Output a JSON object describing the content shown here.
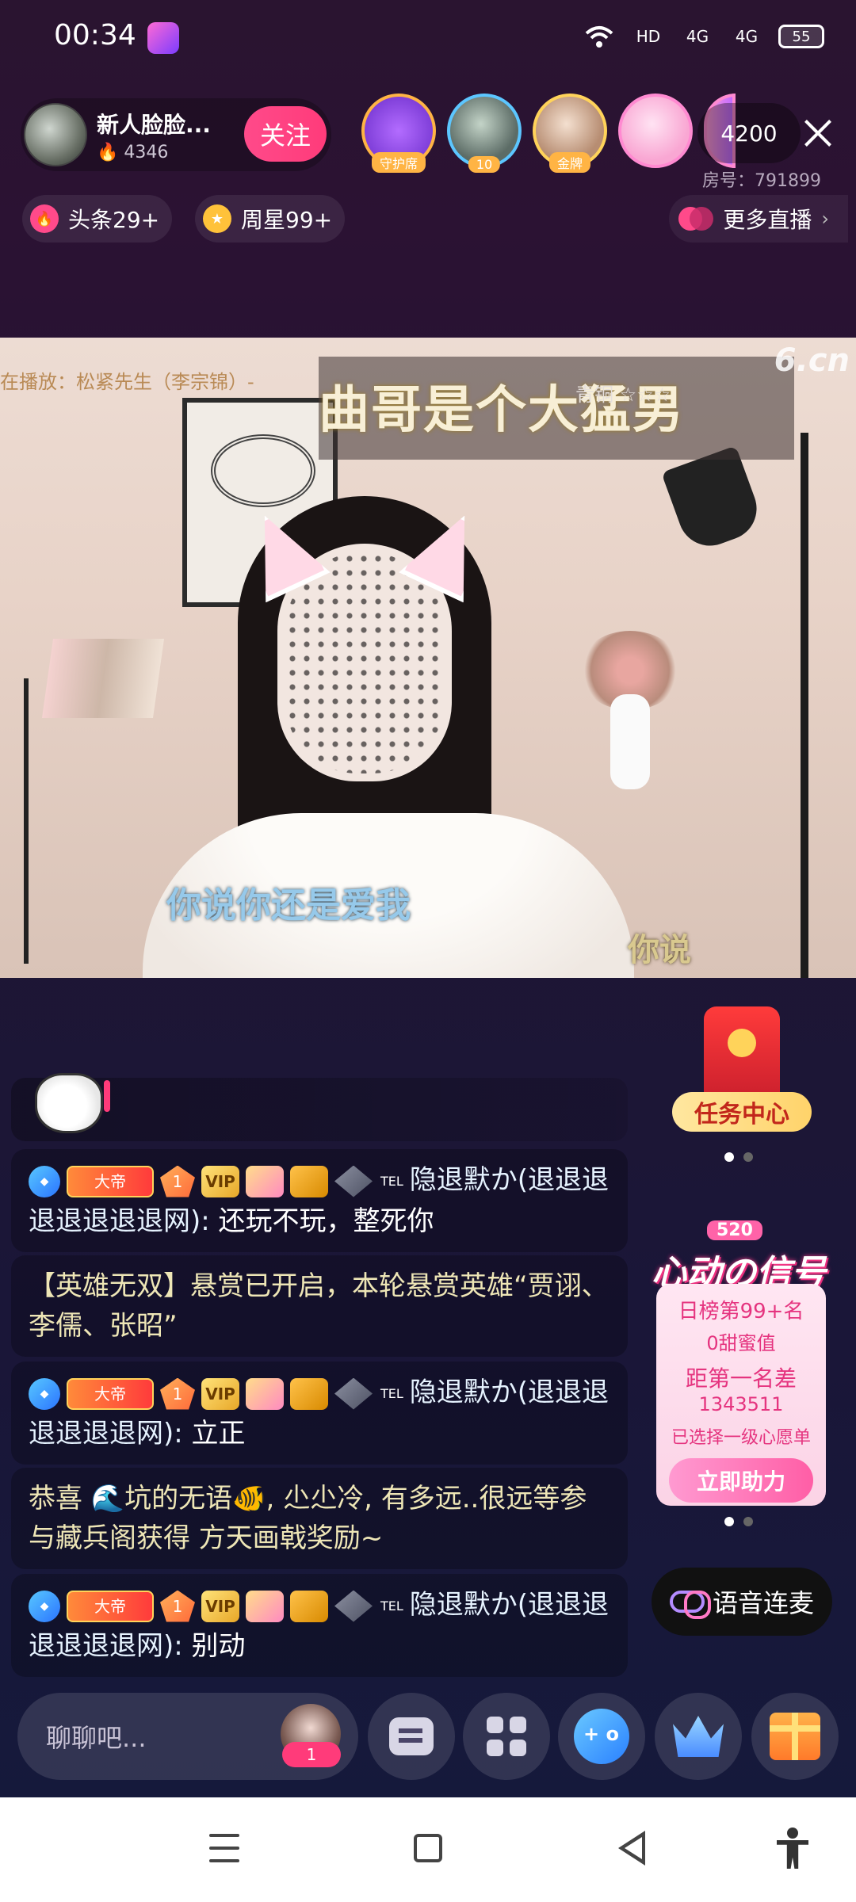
{
  "status_bar": {
    "time": "00:34",
    "network_1": "HD",
    "network_2": "4G",
    "network_3": "4G",
    "battery": "55"
  },
  "header": {
    "anchor_name": "新人脸脸...",
    "anchor_hot": "4346",
    "follow_label": "关注",
    "guard_label": "守护席",
    "viewer_badges": [
      "10",
      "金牌"
    ],
    "viewer_count": "4200",
    "room_id": "房号：791899"
  },
  "tags": {
    "headline": "头条29+",
    "weekly": "周星99+",
    "more_live": "更多直播"
  },
  "video": {
    "now_playing": "在播放：松紧先生（李宗锦）-",
    "song_title": "曲哥是个大猛男",
    "rank_tag": "青铜 ☆☆☆",
    "watermark": "6.cn",
    "lyric_1": "你说你还是爱我",
    "lyric_2": "你说"
  },
  "chat": {
    "badges": {
      "emperor": "大帝",
      "level": "1",
      "vip": "VIP",
      "tel": "TEL"
    },
    "messages": [
      {
        "user": "隐退默か(退退退退退退退退网):",
        "text": " 还玩不玩，整死你"
      },
      {
        "system": "【英雄无双】悬赏已开启，本轮悬赏英雄“贾诩、李儒、张昭”"
      },
      {
        "user": "隐退默か(退退退退退退退网):",
        "text": " 立正"
      },
      {
        "system": "恭喜 🌊坑的无语🐠, 尐尐冷, 有多远..很远等参与藏兵阁获得 方天画戟奖励~"
      },
      {
        "user": "隐退默か(退退退退退退退网):",
        "text": " 别动"
      }
    ]
  },
  "right_panel": {
    "task_center": "任务中心",
    "signal_520": "520",
    "signal_title": "心动の信号",
    "daily_rank": "日榜第99+名",
    "sweetness": "0甜蜜值",
    "gap_label": "距第一名差",
    "gap_value": "1343511",
    "wish_selected": "已选择一级心愿单",
    "boost_label": "立即助力",
    "voice_mic": "语音连麦"
  },
  "bottom_bar": {
    "chat_placeholder": "聊聊吧...",
    "avatar_badge": "1"
  },
  "colors": {
    "accent_pink": "#ff3b7a",
    "bg_top": "#2a1430",
    "bg_bottom": "#141a3c"
  }
}
